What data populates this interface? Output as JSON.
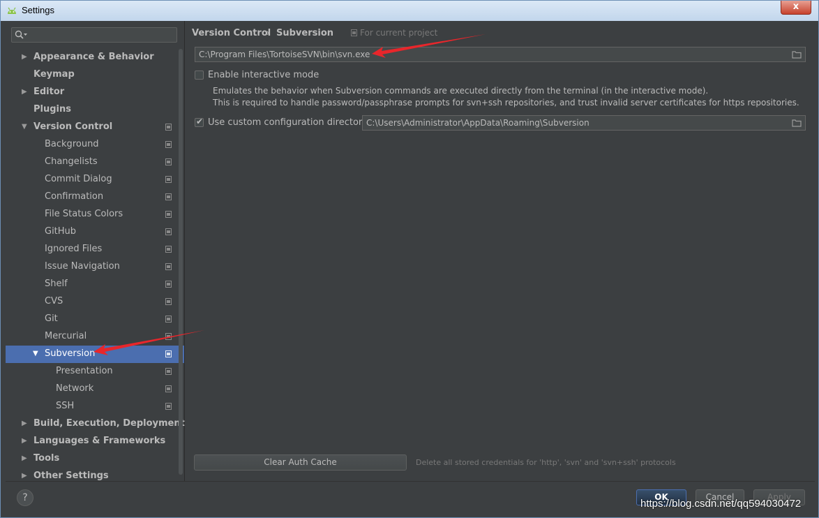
{
  "window": {
    "title": "Settings",
    "close": "x"
  },
  "search": {
    "placeholder": ""
  },
  "sidebar": {
    "items": [
      {
        "label": "Appearance & Behavior",
        "level": 0,
        "bold": true,
        "arrow": "▶"
      },
      {
        "label": "Keymap",
        "level": 0,
        "bold": true,
        "arrow": ""
      },
      {
        "label": "Editor",
        "level": 0,
        "bold": true,
        "arrow": "▶"
      },
      {
        "label": "Plugins",
        "level": 0,
        "bold": true,
        "arrow": ""
      },
      {
        "label": "Version Control",
        "level": 0,
        "bold": true,
        "arrow": "▼",
        "proj": true
      },
      {
        "label": "Background",
        "level": 1,
        "proj": true
      },
      {
        "label": "Changelists",
        "level": 1,
        "proj": true
      },
      {
        "label": "Commit Dialog",
        "level": 1,
        "proj": true
      },
      {
        "label": "Confirmation",
        "level": 1,
        "proj": true
      },
      {
        "label": "File Status Colors",
        "level": 1,
        "proj": true
      },
      {
        "label": "GitHub",
        "level": 1,
        "proj": true
      },
      {
        "label": "Ignored Files",
        "level": 1,
        "proj": true
      },
      {
        "label": "Issue Navigation",
        "level": 1,
        "proj": true
      },
      {
        "label": "Shelf",
        "level": 1,
        "proj": true
      },
      {
        "label": "CVS",
        "level": 1,
        "proj": true
      },
      {
        "label": "Git",
        "level": 1,
        "proj": true
      },
      {
        "label": "Mercurial",
        "level": 1,
        "proj": true
      },
      {
        "label": "Subversion",
        "level": 1,
        "arrow": "▼",
        "proj": true,
        "selected": true
      },
      {
        "label": "Presentation",
        "level": 2,
        "proj": true
      },
      {
        "label": "Network",
        "level": 2,
        "proj": true
      },
      {
        "label": "SSH",
        "level": 2,
        "proj": true
      },
      {
        "label": "Build, Execution, Deployment",
        "level": 0,
        "bold": true,
        "arrow": "▶"
      },
      {
        "label": "Languages & Frameworks",
        "level": 0,
        "bold": true,
        "arrow": "▶"
      },
      {
        "label": "Tools",
        "level": 0,
        "bold": true,
        "arrow": "▶"
      },
      {
        "label": "Other Settings",
        "level": 0,
        "bold": true,
        "arrow": "▶"
      }
    ]
  },
  "main": {
    "breadcrumb": {
      "parent": "Version Control",
      "separator": "›",
      "current": "Subversion"
    },
    "for_current_project": "For current project",
    "svn_path": "C:\\Program Files\\TortoiseSVN\\bin\\svn.exe",
    "interactive_mode": {
      "label": "Enable interactive mode",
      "checked": false,
      "desc1": "Emulates the behavior when Subversion commands are executed directly from the terminal (in the interactive mode).",
      "desc2": "This is required to handle password/passphrase prompts for svn+ssh repositories, and trust invalid server certificates for https repositories."
    },
    "custom_config": {
      "label": "Use custom configuration directory:",
      "checked": true,
      "value": "C:\\Users\\Administrator\\AppData\\Roaming\\Subversion"
    },
    "clear_cache_button": "Clear Auth Cache",
    "clear_cache_hint": "Delete all stored credentials for 'http', 'svn' and 'svn+ssh' protocols"
  },
  "footer": {
    "help": "?",
    "ok": "OK",
    "cancel": "Cancel",
    "apply": "Apply"
  },
  "watermark": "https://blog.csdn.net/qq594030472",
  "colors": {
    "background": "#3c3f41",
    "selection": "#4b6eaf",
    "text": "#bbbbbb",
    "arrow_red": "#e8262b"
  }
}
